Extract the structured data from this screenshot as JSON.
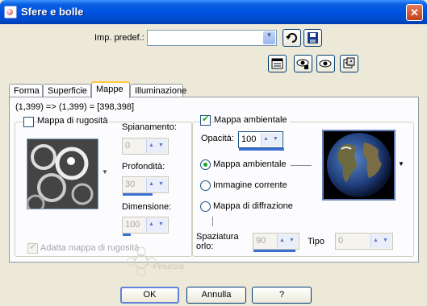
{
  "window": {
    "title": "Sfere e bolle",
    "close": "✕"
  },
  "preset": {
    "label": "Imp. predef.:",
    "value": ""
  },
  "tabs": [
    {
      "label": "Forma"
    },
    {
      "label": "Superficie"
    },
    {
      "label": "Mappe"
    },
    {
      "label": "Illuminazione"
    }
  ],
  "coords": "(1,399) => (1,399) = [398,398]",
  "bump": {
    "checkbox_label": "Mappa di rugosità",
    "smoothing_label": "Spianamento:",
    "smoothing_value": "0",
    "depth_label": "Profondità:",
    "depth_value": "30",
    "size_label": "Dimensione:",
    "size_value": "100",
    "fit_label": "Adatta mappa di rugosità"
  },
  "env": {
    "checkbox_label": "Mappa ambientale",
    "opacity_label": "Opacità:",
    "opacity_value": "100",
    "radio_env": "Mappa ambientale",
    "radio_image": "Immagine corrente",
    "radio_diffraction": "Mappa di diffrazione",
    "spacing_label_1": "Spaziatura",
    "spacing_label_2": "orlo:",
    "spacing_value": "90",
    "type_label": "Tipo",
    "type_value": "0"
  },
  "watermark": "Pinuccia",
  "buttons": {
    "ok": "OK",
    "cancel": "Annulla",
    "help": "?"
  }
}
